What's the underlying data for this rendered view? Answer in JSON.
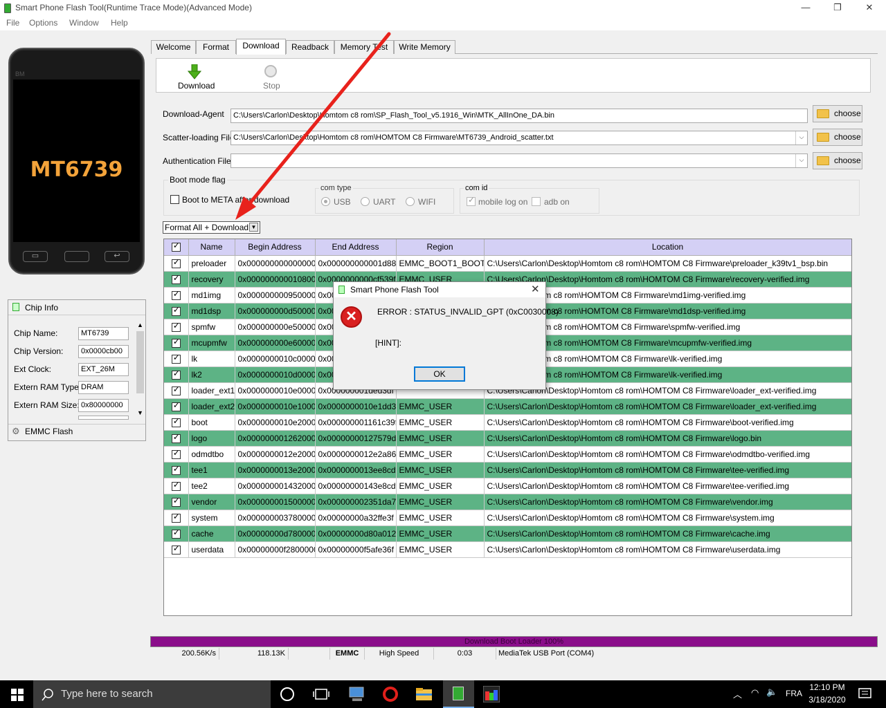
{
  "window": {
    "title": "Smart Phone Flash Tool(Runtime Trace Mode)(Advanced Mode)",
    "minimize": "—",
    "maximize": "❐",
    "close": "✕"
  },
  "menu": [
    "File",
    "Options",
    "Window",
    "Help"
  ],
  "phone": {
    "chip": "MT6739",
    "brand": "BM"
  },
  "chip_info": {
    "title": "Chip Info",
    "rows": [
      {
        "label": "Chip Name:",
        "value": "MT6739"
      },
      {
        "label": "Chip Version:",
        "value": "0x0000cb00"
      },
      {
        "label": "Ext Clock:",
        "value": "EXT_26M"
      },
      {
        "label": "Extern RAM Type:",
        "value": "DRAM"
      },
      {
        "label": "Extern RAM Size:",
        "value": "0x80000000"
      }
    ],
    "emmc_label": "EMMC Flash"
  },
  "tabs": [
    "Welcome",
    "Format",
    "Download",
    "Readback",
    "Memory Test",
    "Write Memory"
  ],
  "active_tab": "Download",
  "toolbar": {
    "download": "Download",
    "stop": "Stop"
  },
  "fields": {
    "download_agent": {
      "label": "Download-Agent",
      "value": "C:\\Users\\Carlon\\Desktop\\Homtom c8 rom\\SP_Flash_Tool_v5.1916_Win\\MTK_AllInOne_DA.bin"
    },
    "scatter": {
      "label": "Scatter-loading File",
      "value": "C:\\Users\\Carlon\\Desktop\\Homtom c8 rom\\HOMTOM C8 Firmware\\MT6739_Android_scatter.txt"
    },
    "auth": {
      "label": "Authentication File",
      "value": ""
    },
    "choose": "choose"
  },
  "boot_mode": {
    "title": "Boot mode flag",
    "meta_label": "Boot to META after download",
    "com_type_title": "com type",
    "com_types": [
      "USB",
      "UART",
      "WIFI"
    ],
    "com_id_title": "com id",
    "mobile_log": "mobile log on",
    "adb": "adb on"
  },
  "mode_select": "Format All + Download",
  "table": {
    "headers": [
      "Name",
      "Begin Address",
      "End Address",
      "Region",
      "Location"
    ],
    "rows": [
      {
        "name": "preloader",
        "begin": "0x0000000000000000",
        "end": "0x000000000001d887",
        "region": "EMMC_BOOT1_BOOT2",
        "location": "C:\\Users\\Carlon\\Desktop\\Homtom c8 rom\\HOMTOM C8 Firmware\\preloader_k39tv1_bsp.bin"
      },
      {
        "name": "recovery",
        "begin": "0x0000000000108000",
        "end": "0x0000000000cf539f",
        "region": "EMMC_USER",
        "location": "C:\\Users\\Carlon\\Desktop\\Homtom c8 rom\\HOMTOM C8 Firmware\\recovery-verified.img"
      },
      {
        "name": "md1img",
        "begin": "0x0000000009500000",
        "end": "0x00",
        "region": "",
        "location": "Desktop\\Homtom c8 rom\\HOMTOM C8 Firmware\\md1img-verified.img"
      },
      {
        "name": "md1dsp",
        "begin": "0x000000000d500000",
        "end": "0x00",
        "region": "",
        "location": "Desktop\\Homtom c8 rom\\HOMTOM C8 Firmware\\md1dsp-verified.img"
      },
      {
        "name": "spmfw",
        "begin": "0x000000000e500000",
        "end": "0x00",
        "region": "",
        "location": "Desktop\\Homtom c8 rom\\HOMTOM C8 Firmware\\spmfw-verified.img"
      },
      {
        "name": "mcupmfw",
        "begin": "0x000000000e600000",
        "end": "0x00",
        "region": "",
        "location": "Desktop\\Homtom c8 rom\\HOMTOM C8 Firmware\\mcupmfw-verified.img"
      },
      {
        "name": "lk",
        "begin": "0x0000000010c00000",
        "end": "0x00",
        "region": "",
        "location": "Desktop\\Homtom c8 rom\\HOMTOM C8 Firmware\\lk-verified.img"
      },
      {
        "name": "lk2",
        "begin": "0x0000000010d00000",
        "end": "0x00",
        "region": "",
        "location": "Desktop\\Homtom c8 rom\\HOMTOM C8 Firmware\\lk-verified.img"
      },
      {
        "name": "loader_ext1",
        "begin": "0x0000000010e00000",
        "end": "0x000000001ded3df",
        "region": "",
        "location": "C:\\Users\\Carlon\\Desktop\\Homtom c8 rom\\HOMTOM C8 Firmware\\loader_ext-verified.img"
      },
      {
        "name": "loader_ext2",
        "begin": "0x0000000010e10000",
        "end": "0x0000000010e1dd3f",
        "region": "EMMC_USER",
        "location": "C:\\Users\\Carlon\\Desktop\\Homtom c8 rom\\HOMTOM C8 Firmware\\loader_ext-verified.img"
      },
      {
        "name": "boot",
        "begin": "0x0000000010e20000",
        "end": "0x000000001161c39f",
        "region": "EMMC_USER",
        "location": "C:\\Users\\Carlon\\Desktop\\Homtom c8 rom\\HOMTOM C8 Firmware\\boot-verified.img"
      },
      {
        "name": "logo",
        "begin": "0x0000000012620000",
        "end": "0x00000000127579df",
        "region": "EMMC_USER",
        "location": "C:\\Users\\Carlon\\Desktop\\Homtom c8 rom\\HOMTOM C8 Firmware\\logo.bin"
      },
      {
        "name": "odmdtbo",
        "begin": "0x0000000012e20000",
        "end": "0x0000000012e2a86f",
        "region": "EMMC_USER",
        "location": "C:\\Users\\Carlon\\Desktop\\Homtom c8 rom\\HOMTOM C8 Firmware\\odmdtbo-verified.img"
      },
      {
        "name": "tee1",
        "begin": "0x0000000013e20000",
        "end": "0x0000000013ee8cdf",
        "region": "EMMC_USER",
        "location": "C:\\Users\\Carlon\\Desktop\\Homtom c8 rom\\HOMTOM C8 Firmware\\tee-verified.img"
      },
      {
        "name": "tee2",
        "begin": "0x0000000014320000",
        "end": "0x00000000143e8cdf",
        "region": "EMMC_USER",
        "location": "C:\\Users\\Carlon\\Desktop\\Homtom c8 rom\\HOMTOM C8 Firmware\\tee-verified.img"
      },
      {
        "name": "vendor",
        "begin": "0x0000000015000000",
        "end": "0x000000002351da7b",
        "region": "EMMC_USER",
        "location": "C:\\Users\\Carlon\\Desktop\\Homtom c8 rom\\HOMTOM C8 Firmware\\vendor.img"
      },
      {
        "name": "system",
        "begin": "0x0000000037800000",
        "end": "0x00000000a32ffe3f",
        "region": "EMMC_USER",
        "location": "C:\\Users\\Carlon\\Desktop\\Homtom c8 rom\\HOMTOM C8 Firmware\\system.img"
      },
      {
        "name": "cache",
        "begin": "0x00000000d7800000",
        "end": "0x00000000d80a012f",
        "region": "EMMC_USER",
        "location": "C:\\Users\\Carlon\\Desktop\\Homtom c8 rom\\HOMTOM C8 Firmware\\cache.img"
      },
      {
        "name": "userdata",
        "begin": "0x00000000f2800000",
        "end": "0x00000000f5afe36f",
        "region": "EMMC_USER",
        "location": "C:\\Users\\Carlon\\Desktop\\Homtom c8 rom\\HOMTOM C8 Firmware\\userdata.img"
      }
    ]
  },
  "dialog": {
    "title": "Smart Phone Flash Tool",
    "message": "ERROR : STATUS_INVALID_GPT (0xC0030008)",
    "hint": "[HINT]:",
    "ok": "OK",
    "close": "✕"
  },
  "progress": {
    "label": "Download Boot Loader 100%",
    "fraction": 1.0,
    "color": "#8a0e8a"
  },
  "status": {
    "speed": "200.56K/s",
    "size": "118.13K",
    "storage": "EMMC",
    "mode": "High Speed",
    "time": "0:03",
    "port": "MediaTek USB Port (COM4)"
  },
  "taskbar": {
    "search_placeholder": "Type here to search",
    "lang": "FRA",
    "time": "12:10 PM",
    "date": "3/18/2020"
  },
  "colors": {
    "row_alt": "#5db385",
    "header": "#d4d0f5",
    "arrow": "#e8221c"
  }
}
